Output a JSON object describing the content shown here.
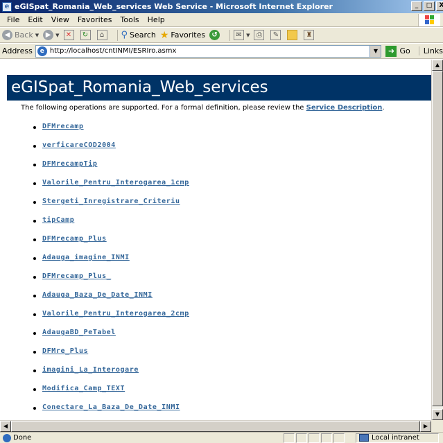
{
  "window": {
    "title": "eGISpat_Romania_Web_services Web Service - Microsoft Internet Explorer",
    "minimize": "_",
    "maximize": "□",
    "close": "X"
  },
  "menu": [
    {
      "label": "File",
      "key": "F"
    },
    {
      "label": "Edit",
      "key": "E"
    },
    {
      "label": "View",
      "key": "V"
    },
    {
      "label": "Favorites",
      "key": "a"
    },
    {
      "label": "Tools",
      "key": "T"
    },
    {
      "label": "Help",
      "key": "H"
    }
  ],
  "toolbar": {
    "back_label": "Back",
    "search_label": "Search",
    "favorites_label": "Favorites"
  },
  "address": {
    "label": "Address",
    "url": "http://localhost/cntINMI/ESRIro.asmx",
    "go_label": "Go",
    "links_label": "Links"
  },
  "page": {
    "heading": "eGISpat_Romania_Web_services",
    "intro_text": "The following operations are supported. For a formal definition, please review the ",
    "intro_link": "Service Description",
    "intro_end": ".",
    "operations": [
      "DFMrecamp",
      "verficareCOD2004",
      "DFMrecampTip",
      "Valorile_Pentru_Interogarea_1cmp",
      "Stergeti_Inregistrare_Criteriu",
      "tipCamp",
      "DFMrecamp_Plus",
      "Adauga_imagine_INMI",
      "DFMrecamp_Plus_",
      "Adauga_Baza_De_Date_INMI",
      "Valorile_Pentru_Interogarea_2cmp",
      "AdaugaBD_PeTabel",
      "DFMre_Plus",
      "imagini_La_Interogare",
      "Modifica_Camp_TEXT",
      "Conectare_La_Baza_De_Date_INMI"
    ]
  },
  "status": {
    "text": "Done",
    "zone": "Local intranet"
  },
  "colors": {
    "banner_bg": "#003366",
    "link": "#336699",
    "title_bar": "#0a246a"
  }
}
